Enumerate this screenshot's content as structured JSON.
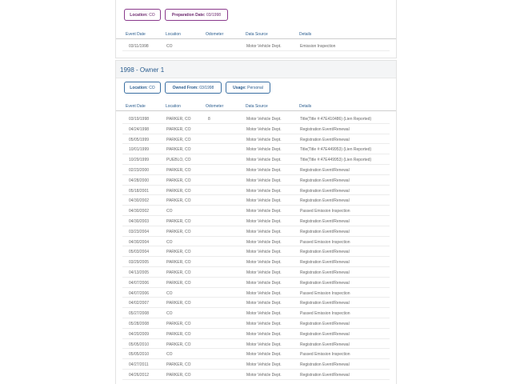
{
  "previous_owner": {
    "chips": [
      {
        "label": "Location:",
        "value": "CO"
      },
      {
        "label": "Preparation Date:",
        "value": "03/1998"
      }
    ],
    "columns": [
      "Event Date",
      "Location",
      "Odometer",
      "Data Source",
      "Details"
    ],
    "rows": [
      {
        "date": "03/11/1998",
        "location": "CO",
        "odometer": "",
        "source": "Motor Vehicle Dept.",
        "details": "Emission Inspection"
      }
    ]
  },
  "owner": {
    "title": "1998 - Owner  1",
    "chips": [
      {
        "label": "Location:",
        "value": "CO"
      },
      {
        "label": "Owned From:",
        "value": "03/1998"
      },
      {
        "label": "Usage:",
        "value": "Personal"
      }
    ],
    "columns": [
      "Event Date",
      "Location",
      "Odometer",
      "Data Source",
      "Details"
    ],
    "rows": [
      {
        "date": "03/19/1998",
        "location": "PARKER, CO",
        "odometer": "8",
        "source": "Motor Vehicle Dept.",
        "details": "Title(Title #:47E410486) (Lien Reported)"
      },
      {
        "date": "04/24/1998",
        "location": "PARKER, CO",
        "odometer": "",
        "source": "Motor Vehicle Dept.",
        "details": "Registration Event/Renewal"
      },
      {
        "date": "05/05/1999",
        "location": "PARKER, CO",
        "odometer": "",
        "source": "Motor Vehicle Dept.",
        "details": "Registration Event/Renewal"
      },
      {
        "date": "10/01/1999",
        "location": "PARKER, CO",
        "odometer": "",
        "source": "Motor Vehicle Dept.",
        "details": "Title(Title #:47E449953) (Lien Reported)"
      },
      {
        "date": "10/29/1999",
        "location": "PUEBLO, CO",
        "odometer": "",
        "source": "Motor Vehicle Dept.",
        "details": "Title(Title #:47E449953) (Lien Reported)"
      },
      {
        "date": "02/23/2000",
        "location": "PARKER, CO",
        "odometer": "",
        "source": "Motor Vehicle Dept.",
        "details": "Registration Event/Renewal"
      },
      {
        "date": "04/28/2000",
        "location": "PARKER, CO",
        "odometer": "",
        "source": "Motor Vehicle Dept.",
        "details": "Registration Event/Renewal"
      },
      {
        "date": "05/18/2001",
        "location": "PARKER, CO",
        "odometer": "",
        "source": "Motor Vehicle Dept.",
        "details": "Registration Event/Renewal"
      },
      {
        "date": "04/30/2002",
        "location": "PARKER, CO",
        "odometer": "",
        "source": "Motor Vehicle Dept.",
        "details": "Registration Event/Renewal"
      },
      {
        "date": "04/30/2002",
        "location": "CO",
        "odometer": "",
        "source": "Motor Vehicle Dept.",
        "details": "Passed Emission Inspection"
      },
      {
        "date": "04/30/2003",
        "location": "PARKER, CO",
        "odometer": "",
        "source": "Motor Vehicle Dept.",
        "details": "Registration Event/Renewal"
      },
      {
        "date": "03/23/2004",
        "location": "PARKER, CO",
        "odometer": "",
        "source": "Motor Vehicle Dept.",
        "details": "Registration Event/Renewal"
      },
      {
        "date": "04/30/2004",
        "location": "CO",
        "odometer": "",
        "source": "Motor Vehicle Dept.",
        "details": "Passed Emission Inspection"
      },
      {
        "date": "05/03/2004",
        "location": "PARKER, CO",
        "odometer": "",
        "source": "Motor Vehicle Dept.",
        "details": "Registration Event/Renewal"
      },
      {
        "date": "03/29/2005",
        "location": "PARKER, CO",
        "odometer": "",
        "source": "Motor Vehicle Dept.",
        "details": "Registration Event/Renewal"
      },
      {
        "date": "04/13/2005",
        "location": "PARKER, CO",
        "odometer": "",
        "source": "Motor Vehicle Dept.",
        "details": "Registration Event/Renewal"
      },
      {
        "date": "04/07/2006",
        "location": "PARKER, CO",
        "odometer": "",
        "source": "Motor Vehicle Dept.",
        "details": "Registration Event/Renewal"
      },
      {
        "date": "04/07/2006",
        "location": "CO",
        "odometer": "",
        "source": "Motor Vehicle Dept.",
        "details": "Passed Emission Inspection"
      },
      {
        "date": "04/02/2007",
        "location": "PARKER, CO",
        "odometer": "",
        "source": "Motor Vehicle Dept.",
        "details": "Registration Event/Renewal"
      },
      {
        "date": "05/27/2008",
        "location": "CO",
        "odometer": "",
        "source": "Motor Vehicle Dept.",
        "details": "Passed Emission Inspection"
      },
      {
        "date": "05/28/2008",
        "location": "PARKER, CO",
        "odometer": "",
        "source": "Motor Vehicle Dept.",
        "details": "Registration Event/Renewal"
      },
      {
        "date": "04/20/2009",
        "location": "PARKER, CO",
        "odometer": "",
        "source": "Motor Vehicle Dept.",
        "details": "Registration Event/Renewal"
      },
      {
        "date": "05/05/2010",
        "location": "PARKER, CO",
        "odometer": "",
        "source": "Motor Vehicle Dept.",
        "details": "Registration Event/Renewal"
      },
      {
        "date": "05/05/2010",
        "location": "CO",
        "odometer": "",
        "source": "Motor Vehicle Dept.",
        "details": "Passed Emission Inspection"
      },
      {
        "date": "04/27/2011",
        "location": "PARKER, CO",
        "odometer": "",
        "source": "Motor Vehicle Dept.",
        "details": "Registration Event/Renewal"
      },
      {
        "date": "04/26/2012",
        "location": "PARKER, CO",
        "odometer": "",
        "source": "Motor Vehicle Dept.",
        "details": "Registration Event/Renewal"
      }
    ]
  }
}
